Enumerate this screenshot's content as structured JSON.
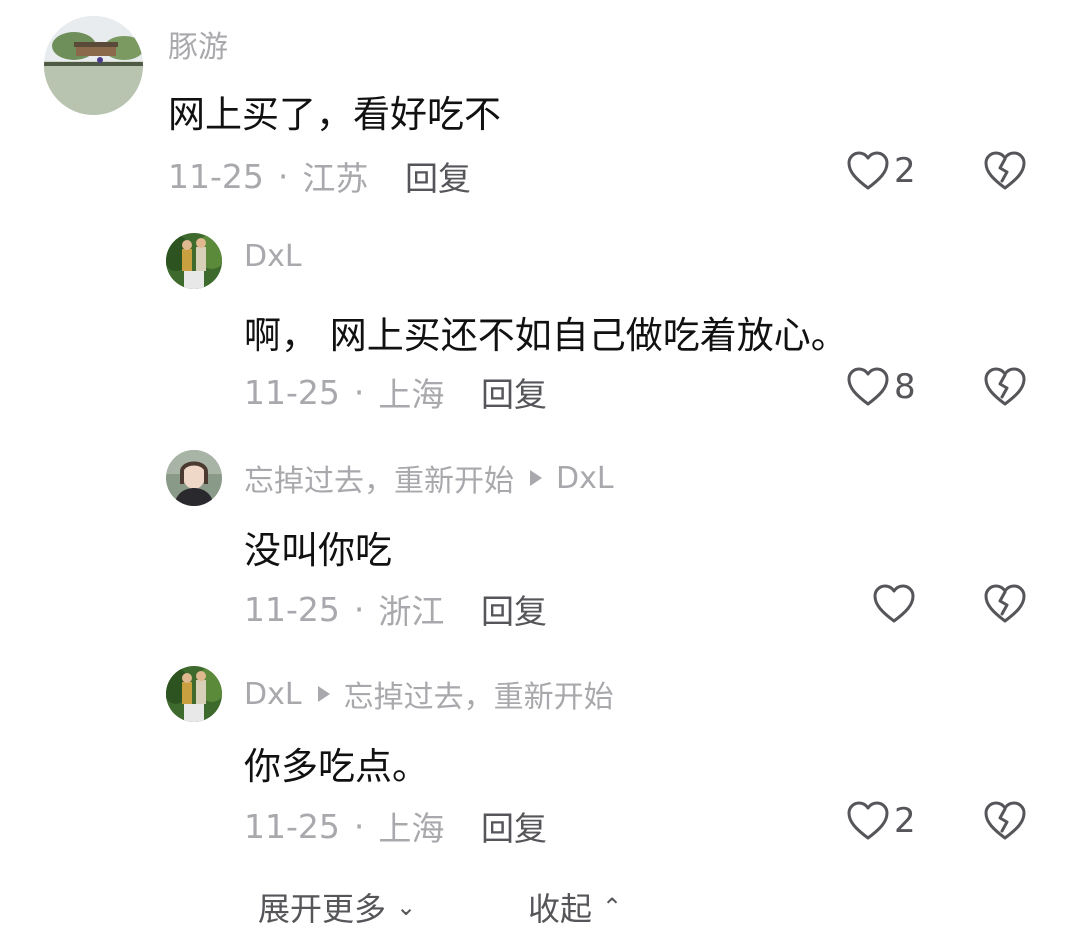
{
  "comments": [
    {
      "username": "豚游",
      "text": "网上买了，看好吃不",
      "date": "11-25",
      "location": "江苏",
      "reply_label": "回复",
      "likes": "2"
    },
    {
      "username": "DxL",
      "text": "啊， 网上买还不如自己做吃着放心。",
      "date": "11-25",
      "location": "上海",
      "reply_label": "回复",
      "likes": "8"
    },
    {
      "username": "忘掉过去，重新开始",
      "reply_to": "DxL",
      "text": "没叫你吃",
      "date": "11-25",
      "location": "浙江",
      "reply_label": "回复",
      "likes": ""
    },
    {
      "username": "DxL",
      "reply_to": "忘掉过去，重新开始",
      "text": "你多吃点。",
      "date": "11-25",
      "location": "上海",
      "reply_label": "回复",
      "likes": "2"
    }
  ],
  "footer": {
    "expand_label": "展开更多",
    "collapse_label": "收起"
  },
  "icons": {
    "like": "heart-outline-icon",
    "dislike": "broken-heart-icon",
    "reply_arrow": "play-arrow-icon",
    "expand": "chevron-down-icon",
    "collapse": "chevron-up-icon"
  },
  "colors": {
    "meta_gray": "#a9a9ad",
    "text_dark": "#111111",
    "icon_gray": "#55555a"
  }
}
